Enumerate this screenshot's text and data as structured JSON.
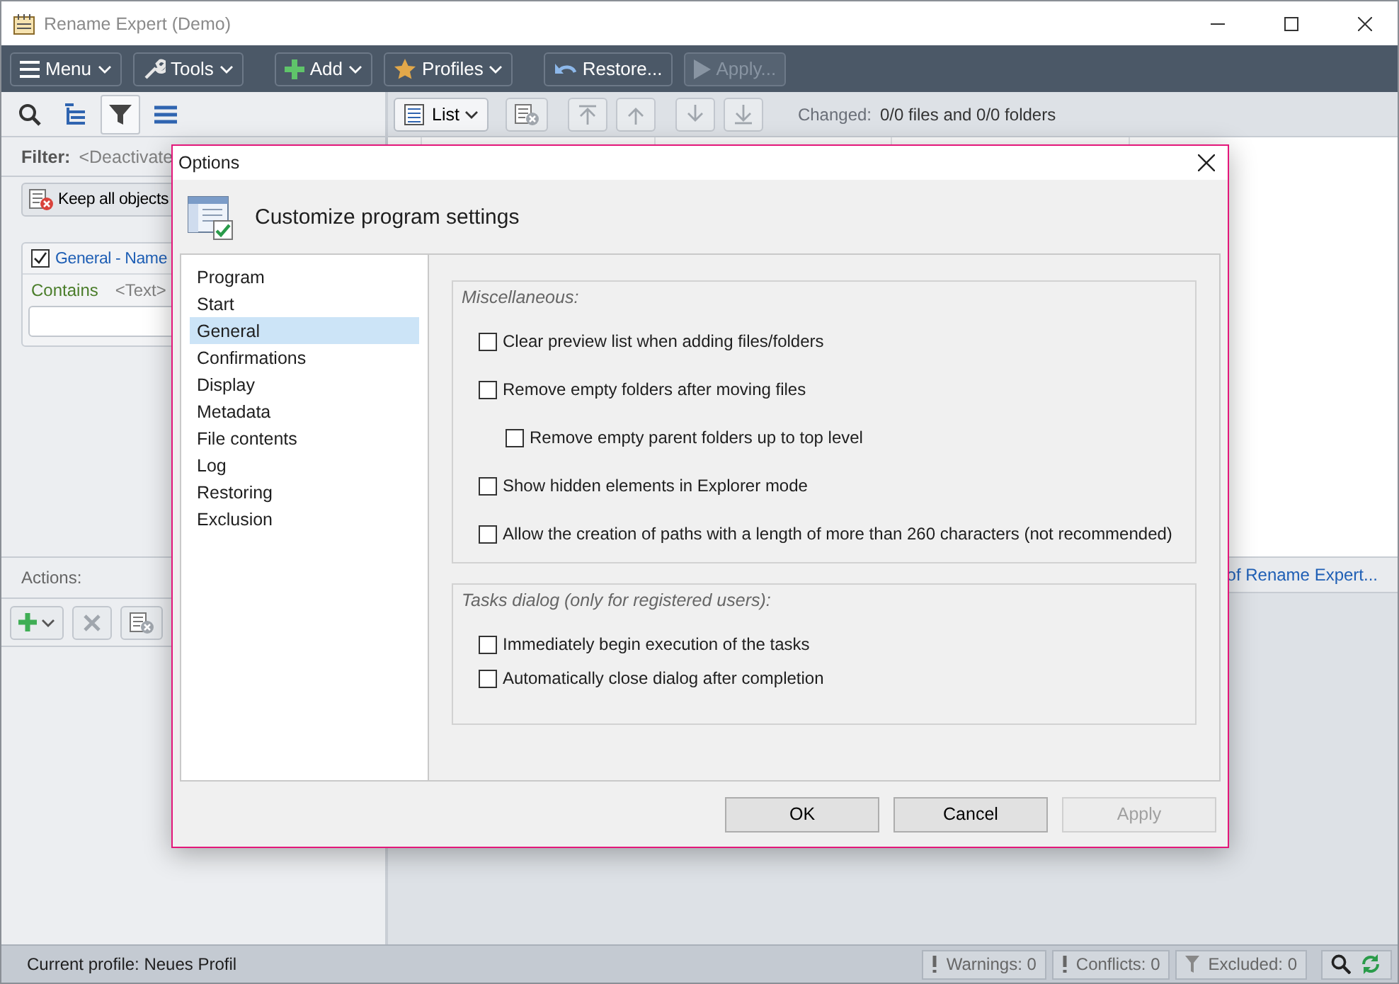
{
  "window": {
    "title": "Rename Expert (Demo)"
  },
  "toolbar": [
    {
      "label": "Menu",
      "dropdown": true,
      "disabled": false
    },
    {
      "label": "Tools",
      "dropdown": true,
      "disabled": false
    },
    {
      "label": "Add",
      "dropdown": true,
      "disabled": false
    },
    {
      "label": "Profiles",
      "dropdown": true,
      "disabled": false
    },
    {
      "label": "Restore...",
      "dropdown": false,
      "disabled": false
    },
    {
      "label": "Apply...",
      "dropdown": false,
      "disabled": true
    }
  ],
  "left_tabs": [
    {
      "selected": false
    },
    {
      "selected": false
    },
    {
      "selected": true
    },
    {
      "selected": false
    }
  ],
  "filter": {
    "label": "Filter:",
    "value": "<Deactivate",
    "keep_button": "Keep all objects"
  },
  "filter_card": {
    "title": "General - Name",
    "checked": true,
    "condition": "Contains",
    "operand": "<Text>"
  },
  "actions": {
    "label": "Actions:"
  },
  "list_toolbar": {
    "view": "List",
    "changed_label": "Changed:",
    "changed_value": "0/0 files and 0/0 folders"
  },
  "info_link": "of Rename Expert...",
  "status_bar": {
    "profile": "Current profile: Neues Profil",
    "counters": [
      "Warnings: 0",
      "Conflicts: 0",
      "Excluded: 0"
    ]
  },
  "dialog": {
    "title": "Options",
    "heading": "Customize program settings",
    "nav": [
      {
        "label": "Program",
        "selected": false
      },
      {
        "label": "Start",
        "selected": false
      },
      {
        "label": "General",
        "selected": true
      },
      {
        "label": "Confirmations",
        "selected": false
      },
      {
        "label": "Display",
        "selected": false
      },
      {
        "label": "Metadata",
        "selected": false
      },
      {
        "label": "File contents",
        "selected": false
      },
      {
        "label": "Log",
        "selected": false
      },
      {
        "label": "Restoring",
        "selected": false
      },
      {
        "label": "Exclusion",
        "selected": false
      }
    ],
    "groups": [
      {
        "title": "Miscellaneous:",
        "options": [
          {
            "label": "Clear preview list when adding files/folders",
            "checked": false
          },
          {
            "label": "Remove empty folders after moving files",
            "checked": false,
            "children": [
              {
                "label": "Remove empty parent folders up to top level",
                "checked": false
              }
            ]
          },
          {
            "label": "Show hidden elements in Explorer mode",
            "checked": false
          },
          {
            "label": "Allow the creation of paths with a length of more than 260 characters (not recommended)",
            "checked": false
          }
        ]
      },
      {
        "title": "Tasks dialog (only for registered users):",
        "options": [
          {
            "label": "Immediately begin execution of the tasks",
            "checked": false
          },
          {
            "label": "Automatically close dialog after completion",
            "checked": false
          }
        ]
      }
    ],
    "buttons": [
      {
        "label": "OK",
        "disabled": false
      },
      {
        "label": "Cancel",
        "disabled": false
      },
      {
        "label": "Apply",
        "disabled": true
      }
    ]
  }
}
